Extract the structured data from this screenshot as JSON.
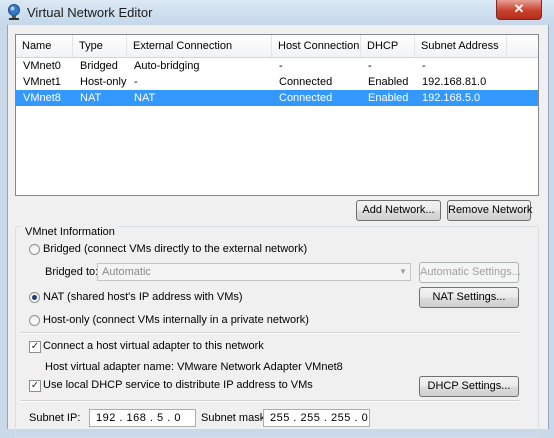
{
  "window": {
    "title": "Virtual Network Editor",
    "close_glyph": "✕",
    "icon": "vmware-network-icon"
  },
  "table": {
    "headers": [
      "Name",
      "Type",
      "External Connection",
      "Host Connection",
      "DHCP",
      "Subnet Address"
    ],
    "rows": [
      [
        "VMnet0",
        "Bridged",
        "Auto-bridging",
        "-",
        "-",
        "-"
      ],
      [
        "VMnet1",
        "Host-only",
        "-",
        "Connected",
        "Enabled",
        "192.168.81.0"
      ],
      [
        "VMnet8",
        "NAT",
        "NAT",
        "Connected",
        "Enabled",
        "192.168.5.0"
      ]
    ],
    "selected_row": 2
  },
  "buttons": {
    "add_network": "Add Network...",
    "remove_network": "Remove Network",
    "automatic_settings": "Automatic Settings...",
    "nat_settings": "NAT Settings...",
    "dhcp_settings": "DHCP Settings..."
  },
  "vmnet_info": {
    "group_label": "VMnet Information",
    "bridged_label": "Bridged (connect VMs directly to the external network)",
    "bridged_to_label": "Bridged to:",
    "bridged_to_value": "Automatic",
    "nat_label": "NAT (shared host's IP address with VMs)",
    "hostonly_label": "Host-only (connect VMs internally in a private network)",
    "selected_mode": "NAT",
    "connect_adapter_label": "Connect a host virtual adapter to this network",
    "connect_adapter_checked": true,
    "adapter_name_text": "Host virtual adapter name: VMware Network Adapter VMnet8",
    "dhcp_label": "Use local DHCP service to distribute IP address to VMs",
    "dhcp_checked": true,
    "subnet_ip_label": "Subnet IP:",
    "subnet_ip_value": "192 . 168 . 5 . 0",
    "subnet_mask_label": "Subnet mask:",
    "subnet_mask_value": "255 . 255 . 255 . 0"
  }
}
